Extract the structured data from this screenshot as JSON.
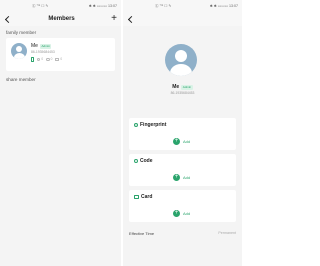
{
  "left": {
    "status": {
      "left": "Ⓒ °ᵗʳᶦ ☐ ✎",
      "right": "✱ ✱ ▭▭▭ 13:07"
    },
    "title": "Members",
    "add_icon": "+",
    "family_label": "family member",
    "member": {
      "name": "Me",
      "badge": "Admin",
      "phone": "86-1935684453",
      "stat_fingerprint": "0",
      "stat_code": "0",
      "stat_card": "0"
    },
    "share_label": "share member"
  },
  "right": {
    "status": {
      "left": "Ⓒ °ᵗʳᶦ ☐ ✎",
      "right": "✱ ✱ ▭▭▭ 13:07"
    },
    "profile": {
      "name": "Me",
      "badge": "Admin",
      "phone": "86-1935684453"
    },
    "sections": {
      "fingerprint": {
        "title": "Fingerprint",
        "add": "Add"
      },
      "code": {
        "title": "Code",
        "add": "Add"
      },
      "card": {
        "title": "Card",
        "add": "Add"
      }
    },
    "effective": {
      "label": "Effective Time",
      "value": "Permanent"
    }
  },
  "colors": {
    "accent": "#2aa46c",
    "badge_bg": "#d9f2e6",
    "avatar": "#8fb0c9",
    "bg": "#f4f4f4"
  }
}
